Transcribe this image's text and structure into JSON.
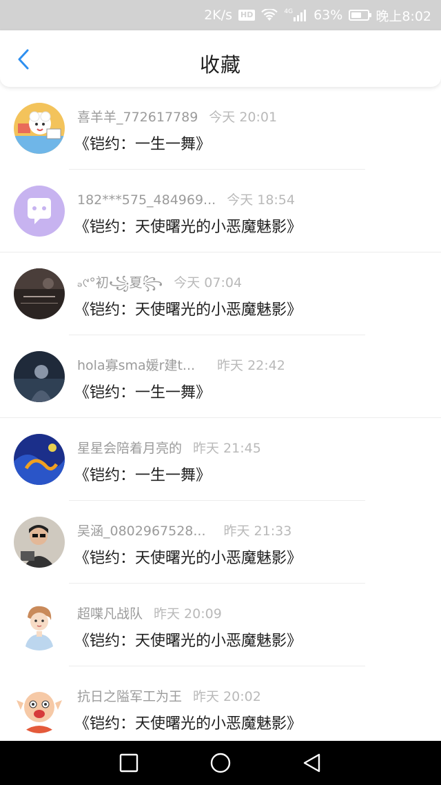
{
  "status_bar": {
    "speed": "2K/s",
    "hd_badge": "HD",
    "network_type": "4G",
    "battery_percent": "63%",
    "battery_level": 0.63,
    "time": "晚上8:02"
  },
  "header": {
    "title": "收藏",
    "back_icon": "chevron-left-icon",
    "accent_color": "#2e8ff0"
  },
  "favorites": [
    {
      "author": "喜羊羊_772617789",
      "time": "今天 20:01",
      "title": "《铠约：一生一舞》"
    },
    {
      "author": "182***575_484969...",
      "time": "今天 18:54",
      "title": "《铠约：天使曙光的小恶魔魅影》"
    },
    {
      "author": "ₔ୯°初꧁夏꧂",
      "time": "今天 07:04",
      "title": "《铠约：天使曙光的小恶魔魅影》"
    },
    {
      "author": "hola寡sma媛r建t...",
      "time": "昨天 22:42",
      "title": "《铠约：一生一舞》"
    },
    {
      "author": "星星会陪着月亮的",
      "time": "昨天 21:45",
      "title": "《铠约：一生一舞》"
    },
    {
      "author": "吴涵_0802967528...",
      "time": "昨天 21:33",
      "title": "《铠约：天使曙光的小恶魔魅影》"
    },
    {
      "author": "超喋凡战队",
      "time": "昨天 20:09",
      "title": "《铠约：天使曙光的小恶魔魅影》"
    },
    {
      "author": "抗日之隘军工为王",
      "time": "昨天 20:02",
      "title": "《铠约：天使曙光的小恶魔魅影》"
    }
  ],
  "nav_bar": {
    "recent_icon": "square-icon",
    "home_icon": "circle-icon",
    "back_icon": "triangle-back-icon"
  }
}
